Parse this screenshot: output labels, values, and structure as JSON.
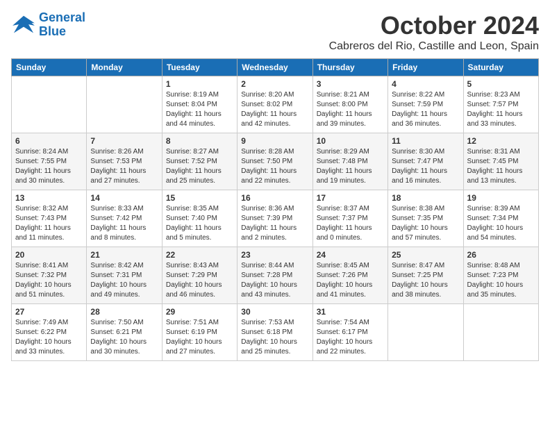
{
  "logo": {
    "line1": "General",
    "line2": "Blue"
  },
  "title": "October 2024",
  "subtitle": "Cabreros del Rio, Castille and Leon, Spain",
  "days_of_week": [
    "Sunday",
    "Monday",
    "Tuesday",
    "Wednesday",
    "Thursday",
    "Friday",
    "Saturday"
  ],
  "weeks": [
    [
      {
        "day": "",
        "info": ""
      },
      {
        "day": "",
        "info": ""
      },
      {
        "day": "1",
        "info": "Sunrise: 8:19 AM\nSunset: 8:04 PM\nDaylight: 11 hours and 44 minutes."
      },
      {
        "day": "2",
        "info": "Sunrise: 8:20 AM\nSunset: 8:02 PM\nDaylight: 11 hours and 42 minutes."
      },
      {
        "day": "3",
        "info": "Sunrise: 8:21 AM\nSunset: 8:00 PM\nDaylight: 11 hours and 39 minutes."
      },
      {
        "day": "4",
        "info": "Sunrise: 8:22 AM\nSunset: 7:59 PM\nDaylight: 11 hours and 36 minutes."
      },
      {
        "day": "5",
        "info": "Sunrise: 8:23 AM\nSunset: 7:57 PM\nDaylight: 11 hours and 33 minutes."
      }
    ],
    [
      {
        "day": "6",
        "info": "Sunrise: 8:24 AM\nSunset: 7:55 PM\nDaylight: 11 hours and 30 minutes."
      },
      {
        "day": "7",
        "info": "Sunrise: 8:26 AM\nSunset: 7:53 PM\nDaylight: 11 hours and 27 minutes."
      },
      {
        "day": "8",
        "info": "Sunrise: 8:27 AM\nSunset: 7:52 PM\nDaylight: 11 hours and 25 minutes."
      },
      {
        "day": "9",
        "info": "Sunrise: 8:28 AM\nSunset: 7:50 PM\nDaylight: 11 hours and 22 minutes."
      },
      {
        "day": "10",
        "info": "Sunrise: 8:29 AM\nSunset: 7:48 PM\nDaylight: 11 hours and 19 minutes."
      },
      {
        "day": "11",
        "info": "Sunrise: 8:30 AM\nSunset: 7:47 PM\nDaylight: 11 hours and 16 minutes."
      },
      {
        "day": "12",
        "info": "Sunrise: 8:31 AM\nSunset: 7:45 PM\nDaylight: 11 hours and 13 minutes."
      }
    ],
    [
      {
        "day": "13",
        "info": "Sunrise: 8:32 AM\nSunset: 7:43 PM\nDaylight: 11 hours and 11 minutes."
      },
      {
        "day": "14",
        "info": "Sunrise: 8:33 AM\nSunset: 7:42 PM\nDaylight: 11 hours and 8 minutes."
      },
      {
        "day": "15",
        "info": "Sunrise: 8:35 AM\nSunset: 7:40 PM\nDaylight: 11 hours and 5 minutes."
      },
      {
        "day": "16",
        "info": "Sunrise: 8:36 AM\nSunset: 7:39 PM\nDaylight: 11 hours and 2 minutes."
      },
      {
        "day": "17",
        "info": "Sunrise: 8:37 AM\nSunset: 7:37 PM\nDaylight: 11 hours and 0 minutes."
      },
      {
        "day": "18",
        "info": "Sunrise: 8:38 AM\nSunset: 7:35 PM\nDaylight: 10 hours and 57 minutes."
      },
      {
        "day": "19",
        "info": "Sunrise: 8:39 AM\nSunset: 7:34 PM\nDaylight: 10 hours and 54 minutes."
      }
    ],
    [
      {
        "day": "20",
        "info": "Sunrise: 8:41 AM\nSunset: 7:32 PM\nDaylight: 10 hours and 51 minutes."
      },
      {
        "day": "21",
        "info": "Sunrise: 8:42 AM\nSunset: 7:31 PM\nDaylight: 10 hours and 49 minutes."
      },
      {
        "day": "22",
        "info": "Sunrise: 8:43 AM\nSunset: 7:29 PM\nDaylight: 10 hours and 46 minutes."
      },
      {
        "day": "23",
        "info": "Sunrise: 8:44 AM\nSunset: 7:28 PM\nDaylight: 10 hours and 43 minutes."
      },
      {
        "day": "24",
        "info": "Sunrise: 8:45 AM\nSunset: 7:26 PM\nDaylight: 10 hours and 41 minutes."
      },
      {
        "day": "25",
        "info": "Sunrise: 8:47 AM\nSunset: 7:25 PM\nDaylight: 10 hours and 38 minutes."
      },
      {
        "day": "26",
        "info": "Sunrise: 8:48 AM\nSunset: 7:23 PM\nDaylight: 10 hours and 35 minutes."
      }
    ],
    [
      {
        "day": "27",
        "info": "Sunrise: 7:49 AM\nSunset: 6:22 PM\nDaylight: 10 hours and 33 minutes."
      },
      {
        "day": "28",
        "info": "Sunrise: 7:50 AM\nSunset: 6:21 PM\nDaylight: 10 hours and 30 minutes."
      },
      {
        "day": "29",
        "info": "Sunrise: 7:51 AM\nSunset: 6:19 PM\nDaylight: 10 hours and 27 minutes."
      },
      {
        "day": "30",
        "info": "Sunrise: 7:53 AM\nSunset: 6:18 PM\nDaylight: 10 hours and 25 minutes."
      },
      {
        "day": "31",
        "info": "Sunrise: 7:54 AM\nSunset: 6:17 PM\nDaylight: 10 hours and 22 minutes."
      },
      {
        "day": "",
        "info": ""
      },
      {
        "day": "",
        "info": ""
      }
    ]
  ]
}
